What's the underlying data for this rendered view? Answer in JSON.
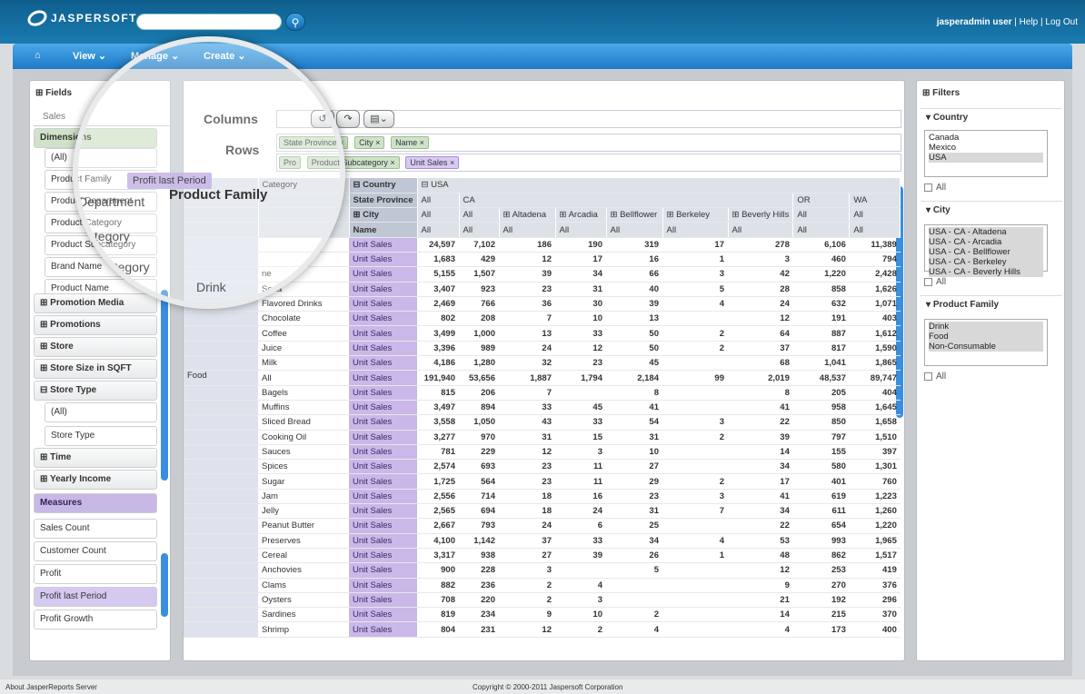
{
  "header": {
    "logo_text": "JASPERSOFT",
    "search_placeholder": "",
    "user": "jasperadmin user",
    "help": "Help",
    "logout": "Log Out"
  },
  "nav": {
    "view": "View",
    "manage": "Manage",
    "create": "Create"
  },
  "fields": {
    "title": "Fields",
    "tab": "Sales",
    "dimensions_label": "Dimensions",
    "items": {
      "all": "(All)",
      "family": "Product Family",
      "department": "Product Department",
      "category": "Product Category",
      "subcategory": "Product Subcategory",
      "brand": "Brand Name",
      "product_name": "Product Name",
      "promotion_media": "Promotion Media",
      "promotions": "Promotions",
      "store": "Store",
      "store_size": "Store Size in SQFT",
      "store_type": "Store Type",
      "store_type_all": "(All)",
      "store_type_child": "Store Type",
      "time": "Time",
      "yearly_income": "Yearly Income"
    },
    "measures_label": "Measures",
    "measures": [
      "Sales Count",
      "Customer Count",
      "Profit",
      "Profit last Period",
      "Profit Growth"
    ]
  },
  "drag_tooltip": "Profit last Period",
  "magnified": {
    "family": "Product Family",
    "dept": "Department",
    "cat": "Category",
    "subcat": "Subcategory",
    "drink": "Drink",
    "pro1": "Pro",
    "pro2": "Pro"
  },
  "center": {
    "columns_label": "Columns",
    "rows_label": "Rows",
    "row_chips_1": [
      "State Province",
      "City",
      "Name"
    ],
    "row_chips_2": [
      "Product Subcategory"
    ],
    "measure_chip": "Unit Sales",
    "pro_chip": "Pro"
  },
  "pivot": {
    "header1": [
      "Country",
      "USA"
    ],
    "header_state": [
      "State Province",
      "All",
      "CA",
      "OR",
      "WA"
    ],
    "header_city": [
      "City",
      "All",
      "All",
      "Altadena",
      "Arcadia",
      "Bellflower",
      "Berkeley",
      "Beverly Hills",
      "All",
      "All"
    ],
    "header_name": [
      "Name",
      "All",
      "All",
      "All",
      "All",
      "All",
      "All",
      "All",
      "All",
      "All"
    ],
    "category_label": "Category",
    "measure_label": "Unit Sales",
    "family_drink": "Drink",
    "family_food": "Food",
    "rows": [
      {
        "fam": "",
        "prod": "",
        "v": [
          "24,597",
          "7,102",
          "186",
          "190",
          "319",
          "17",
          "278",
          "6,106",
          "11,389"
        ]
      },
      {
        "fam": "",
        "prod": "",
        "v": [
          "1,683",
          "429",
          "12",
          "17",
          "16",
          "1",
          "3",
          "460",
          "794"
        ]
      },
      {
        "fam": "",
        "prod": "ne",
        "v": [
          "5,155",
          "1,507",
          "39",
          "34",
          "66",
          "3",
          "42",
          "1,220",
          "2,428"
        ]
      },
      {
        "fam": "",
        "prod": "Soda",
        "v": [
          "3,407",
          "923",
          "23",
          "31",
          "40",
          "5",
          "28",
          "858",
          "1,626"
        ]
      },
      {
        "fam": "",
        "prod": "Flavored Drinks",
        "v": [
          "2,469",
          "766",
          "36",
          "30",
          "39",
          "4",
          "24",
          "632",
          "1,071"
        ]
      },
      {
        "fam": "",
        "prod": "Chocolate",
        "v": [
          "802",
          "208",
          "7",
          "10",
          "13",
          "",
          "12",
          "191",
          "403"
        ]
      },
      {
        "fam": "",
        "prod": "Coffee",
        "v": [
          "3,499",
          "1,000",
          "13",
          "33",
          "50",
          "2",
          "64",
          "887",
          "1,612"
        ]
      },
      {
        "fam": "",
        "prod": "Juice",
        "v": [
          "3,396",
          "989",
          "24",
          "12",
          "50",
          "2",
          "37",
          "817",
          "1,590"
        ]
      },
      {
        "fam": "",
        "prod": "Milk",
        "v": [
          "4,186",
          "1,280",
          "32",
          "23",
          "45",
          "",
          "68",
          "1,041",
          "1,865"
        ]
      },
      {
        "fam": "Food",
        "prod": "All",
        "v": [
          "191,940",
          "53,656",
          "1,887",
          "1,794",
          "2,184",
          "99",
          "2,019",
          "48,537",
          "89,747"
        ]
      },
      {
        "fam": "",
        "prod": "Bagels",
        "v": [
          "815",
          "206",
          "7",
          "",
          "8",
          "",
          "8",
          "205",
          "404"
        ]
      },
      {
        "fam": "",
        "prod": "Muffins",
        "v": [
          "3,497",
          "894",
          "33",
          "45",
          "41",
          "",
          "41",
          "958",
          "1,645"
        ]
      },
      {
        "fam": "",
        "prod": "Sliced Bread",
        "v": [
          "3,558",
          "1,050",
          "43",
          "33",
          "54",
          "3",
          "22",
          "850",
          "1,658"
        ]
      },
      {
        "fam": "",
        "prod": "Cooking Oil",
        "v": [
          "3,277",
          "970",
          "31",
          "15",
          "31",
          "2",
          "39",
          "797",
          "1,510"
        ]
      },
      {
        "fam": "",
        "prod": "Sauces",
        "v": [
          "781",
          "229",
          "12",
          "3",
          "10",
          "",
          "14",
          "155",
          "397"
        ]
      },
      {
        "fam": "",
        "prod": "Spices",
        "v": [
          "2,574",
          "693",
          "23",
          "11",
          "27",
          "",
          "34",
          "580",
          "1,301"
        ]
      },
      {
        "fam": "",
        "prod": "Sugar",
        "v": [
          "1,725",
          "564",
          "23",
          "11",
          "29",
          "2",
          "17",
          "401",
          "760"
        ]
      },
      {
        "fam": "",
        "prod": "Jam",
        "v": [
          "2,556",
          "714",
          "18",
          "16",
          "23",
          "3",
          "41",
          "619",
          "1,223"
        ]
      },
      {
        "fam": "",
        "prod": "Jelly",
        "v": [
          "2,565",
          "694",
          "18",
          "24",
          "31",
          "7",
          "34",
          "611",
          "1,260"
        ]
      },
      {
        "fam": "",
        "prod": "Peanut Butter",
        "v": [
          "2,667",
          "793",
          "24",
          "6",
          "25",
          "",
          "22",
          "654",
          "1,220"
        ]
      },
      {
        "fam": "",
        "prod": "Preserves",
        "v": [
          "4,100",
          "1,142",
          "37",
          "33",
          "34",
          "4",
          "53",
          "993",
          "1,965"
        ]
      },
      {
        "fam": "",
        "prod": "Cereal",
        "v": [
          "3,317",
          "938",
          "27",
          "39",
          "26",
          "1",
          "48",
          "862",
          "1,517"
        ]
      },
      {
        "fam": "",
        "prod": "Anchovies",
        "v": [
          "900",
          "228",
          "3",
          "",
          "5",
          "",
          "12",
          "253",
          "419"
        ]
      },
      {
        "fam": "",
        "prod": "Clams",
        "v": [
          "882",
          "236",
          "2",
          "4",
          "",
          "",
          "9",
          "270",
          "376"
        ]
      },
      {
        "fam": "",
        "prod": "Oysters",
        "v": [
          "708",
          "220",
          "2",
          "3",
          "",
          "",
          "21",
          "192",
          "296"
        ]
      },
      {
        "fam": "",
        "prod": "Sardines",
        "v": [
          "819",
          "234",
          "9",
          "10",
          "2",
          "",
          "14",
          "215",
          "370"
        ]
      },
      {
        "fam": "",
        "prod": "Shrimp",
        "v": [
          "804",
          "231",
          "12",
          "2",
          "4",
          "",
          "4",
          "173",
          "400"
        ]
      }
    ]
  },
  "filters": {
    "title": "Filters",
    "country": {
      "label": "Country",
      "options": [
        "Canada",
        "Mexico",
        "USA"
      ],
      "all": "All"
    },
    "city": {
      "label": "City",
      "options": [
        "USA - CA - Altadena",
        "USA - CA - Arcadia",
        "USA - CA - Bellflower",
        "USA - CA - Berkeley",
        "USA - CA - Beverly Hills"
      ],
      "all": "All"
    },
    "family": {
      "label": "Product Family",
      "options": [
        "Drink",
        "Food",
        "Non-Consumable"
      ],
      "all": "All"
    }
  },
  "footer": {
    "left": "About JasperReports Server",
    "center": "Copyright © 2000-2011 Jaspersoft Corporation"
  }
}
